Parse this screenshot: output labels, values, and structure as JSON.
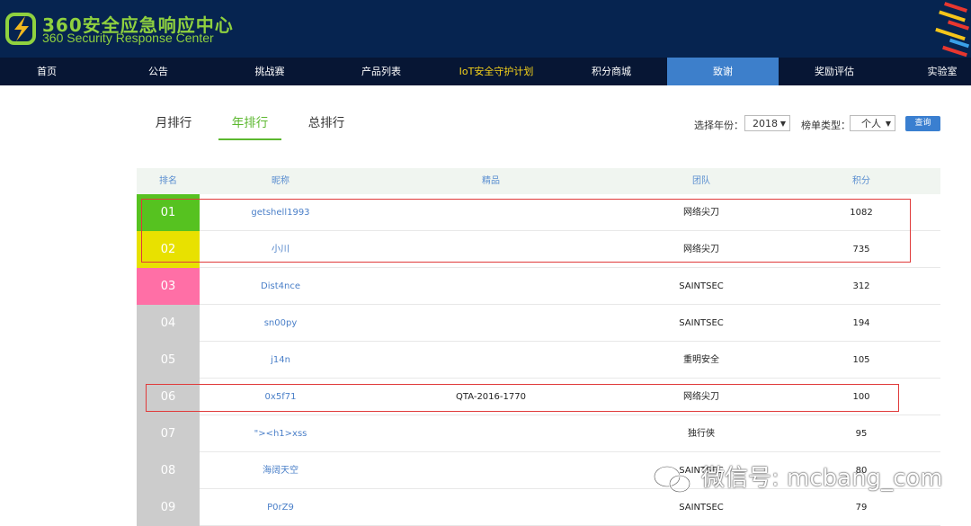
{
  "header": {
    "logo_cn": "360安全应急响应中心",
    "logo_en": "360 Security Response Center",
    "background": "#062450",
    "accent": "#8fd13f"
  },
  "nav": {
    "items": [
      "首页",
      "公告",
      "挑战赛",
      "产品列表",
      "IoT安全守护计划",
      "积分商城",
      "致谢",
      "奖励评估",
      "实验室"
    ],
    "active_index": 6,
    "highlight_index": 4
  },
  "tabs": {
    "items": [
      "月排行",
      "年排行",
      "总排行"
    ],
    "active_index": 1
  },
  "filters": {
    "year_label": "选择年份：",
    "year_value": "2018",
    "type_label": "榜单类型：",
    "type_value": "个人",
    "query_button": "查询"
  },
  "table": {
    "headers": [
      "排名",
      "昵称",
      "精品",
      "团队",
      "积分"
    ],
    "rows": [
      {
        "rank": "01",
        "nick": "getshell1993",
        "product": "",
        "team": "网络尖刀",
        "score": "1082",
        "color": "#56c220"
      },
      {
        "rank": "02",
        "nick": "小川",
        "product": "",
        "team": "网络尖刀",
        "score": "735",
        "color": "#e8e100"
      },
      {
        "rank": "03",
        "nick": "Dist4nce",
        "product": "",
        "team": "SAINTSEC",
        "score": "312",
        "color": "#ff6fa6"
      },
      {
        "rank": "04",
        "nick": "sn00py",
        "product": "",
        "team": "SAINTSEC",
        "score": "194",
        "color": "#cccccc"
      },
      {
        "rank": "05",
        "nick": "j14n",
        "product": "",
        "team": "重明安全",
        "score": "105",
        "color": "#cccccc"
      },
      {
        "rank": "06",
        "nick": "0x5f71",
        "product": "QTA-2016-1770",
        "team": "网络尖刀",
        "score": "100",
        "color": "#cccccc"
      },
      {
        "rank": "07",
        "nick": "\"><h1>xss",
        "product": "",
        "team": "独行侠",
        "score": "95",
        "color": "#cccccc"
      },
      {
        "rank": "08",
        "nick": "海阔天空",
        "product": "",
        "team": "SAINTSEC",
        "score": "80",
        "color": "#cccccc"
      },
      {
        "rank": "09",
        "nick": "P0rZ9",
        "product": "",
        "team": "SAINTSEC",
        "score": "79",
        "color": "#cccccc"
      }
    ]
  },
  "watermark": {
    "text": "微信号: mcbang_com"
  }
}
